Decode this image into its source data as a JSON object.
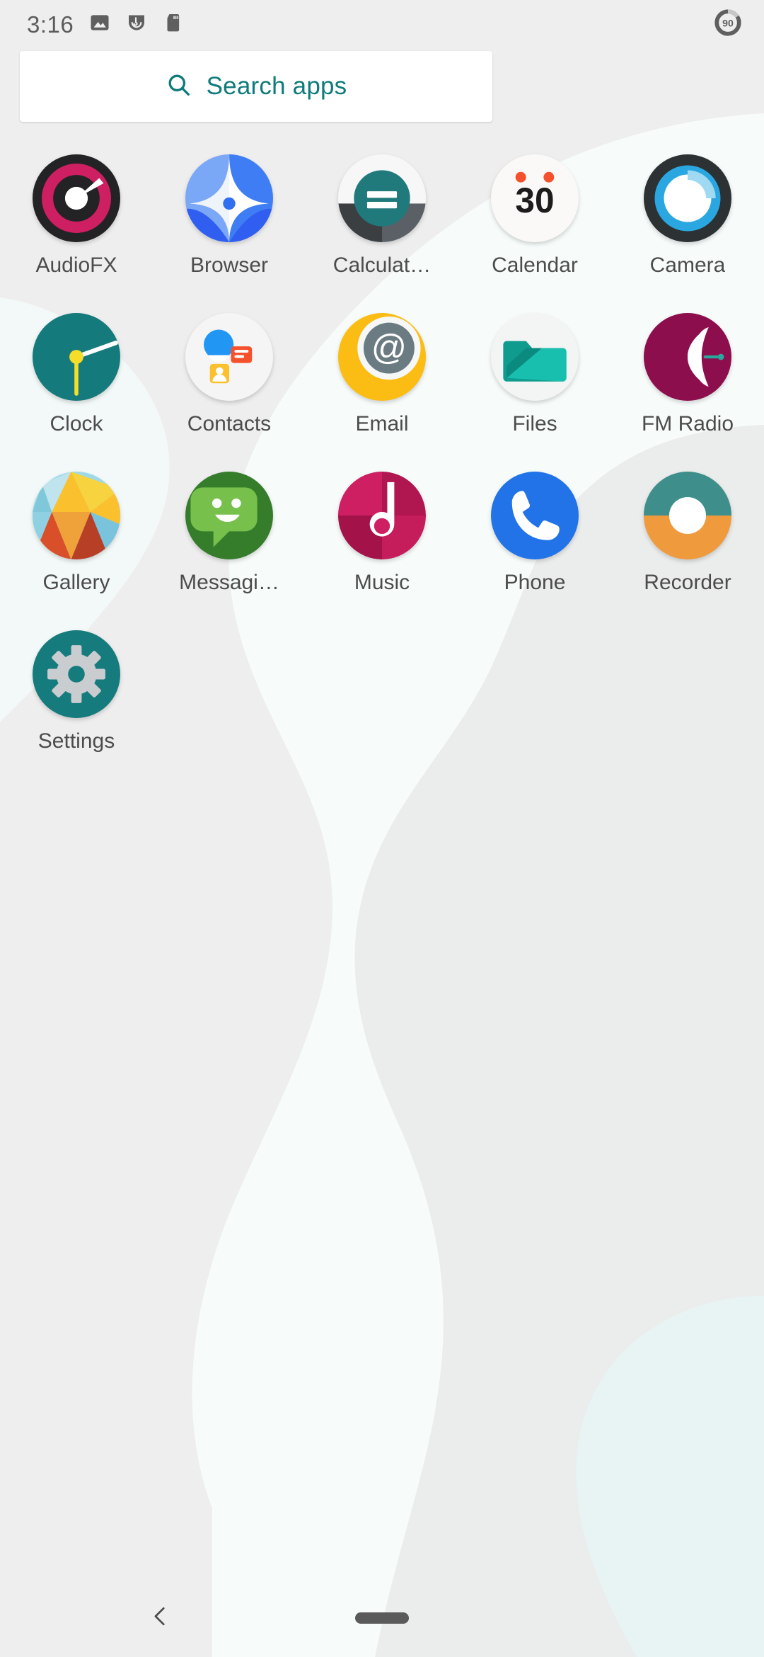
{
  "status_bar": {
    "clock": "3:16",
    "icons": [
      {
        "name": "image-icon",
        "label": "Screenshot"
      },
      {
        "name": "adblock-icon",
        "label": "Ad block"
      },
      {
        "name": "sd-card-icon",
        "label": "SD card"
      }
    ],
    "battery": {
      "name": "battery-icon",
      "percent": "90"
    }
  },
  "search": {
    "placeholder": "Search apps",
    "icon": "search-icon",
    "accent_color": "#0f7b7b"
  },
  "apps": [
    {
      "label": "AudioFX",
      "icon": "audiofx-icon"
    },
    {
      "label": "Browser",
      "icon": "browser-icon"
    },
    {
      "label": "Calculat…",
      "icon": "calculator-icon"
    },
    {
      "label": "Calendar",
      "icon": "calendar-icon"
    },
    {
      "label": "Camera",
      "icon": "camera-icon"
    },
    {
      "label": "Clock",
      "icon": "clock-icon"
    },
    {
      "label": "Contacts",
      "icon": "contacts-icon"
    },
    {
      "label": "Email",
      "icon": "email-icon"
    },
    {
      "label": "Files",
      "icon": "files-icon"
    },
    {
      "label": "FM Radio",
      "icon": "fm-radio-icon"
    },
    {
      "label": "Gallery",
      "icon": "gallery-icon"
    },
    {
      "label": "Messagi…",
      "icon": "messaging-icon"
    },
    {
      "label": "Music",
      "icon": "music-icon"
    },
    {
      "label": "Phone",
      "icon": "phone-icon"
    },
    {
      "label": "Recorder",
      "icon": "recorder-icon"
    },
    {
      "label": "Settings",
      "icon": "settings-icon"
    }
  ],
  "calendar_icon": {
    "day": "30"
  },
  "nav_bar": {
    "back": "back-chevron-icon",
    "home": "home-pill"
  },
  "colors": {
    "background": "#eeeeee",
    "accent": "#0f7b7b",
    "label_text": "#4c4c4c",
    "status_text": "#5b5b5b"
  }
}
